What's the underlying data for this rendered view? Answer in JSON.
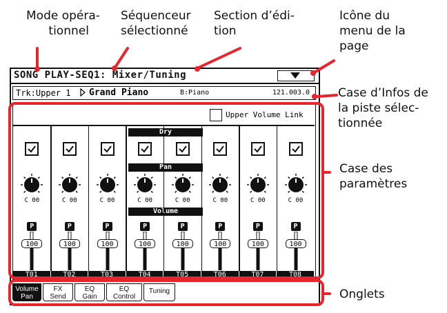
{
  "callouts": {
    "mode": "Mode opéra-\n      tionnel",
    "seq": "Séquenceur\nsélectionné",
    "edit": "Section d’édi-\ntion",
    "menu_icon": "Icône du\nmenu de la\npage",
    "track_info": "Case d’Infos de\nla piste sélec-\ntionnée",
    "params": "Case des\nparamètres",
    "tabs": "Onglets"
  },
  "screen": {
    "title": "SONG PLAY-SEQ1: Mixer/Tuning",
    "info": {
      "track": "Trk:Upper 1",
      "sound": "Grand Piano",
      "bank": "B:Piano",
      "position": "121.003.0"
    },
    "upper_volume_link": "Upper Volume Link",
    "labels": {
      "dry": "Dry",
      "pan": "Pan",
      "volume": "Volume"
    },
    "tracks": [
      {
        "name": "T01",
        "pan": "C 00",
        "volume": "100",
        "badge": "P"
      },
      {
        "name": "T02",
        "pan": "C 00",
        "volume": "100",
        "badge": "P"
      },
      {
        "name": "T03",
        "pan": "C 00",
        "volume": "100",
        "badge": "P"
      },
      {
        "name": "T04",
        "pan": "C 00",
        "volume": "100",
        "badge": "P"
      },
      {
        "name": "T05",
        "pan": "C 00",
        "volume": "100",
        "badge": "P"
      },
      {
        "name": "T06",
        "pan": "C 00",
        "volume": "100",
        "badge": "P"
      },
      {
        "name": "T07",
        "pan": "C 00",
        "volume": "100",
        "badge": "P"
      },
      {
        "name": "T08",
        "pan": "C 00",
        "volume": "100",
        "badge": "P"
      }
    ],
    "tabs": [
      {
        "line1": "Volume",
        "line2": "Pan",
        "active": true
      },
      {
        "line1": "FX",
        "line2": "Send",
        "active": false
      },
      {
        "line1": "EQ",
        "line2": "Gain",
        "active": false
      },
      {
        "line1": "EQ",
        "line2": "Control",
        "active": false
      },
      {
        "line1": "Tuning",
        "line2": "",
        "active": false
      }
    ]
  },
  "colors": {
    "highlight": "#e8242c",
    "ink": "#111111"
  }
}
